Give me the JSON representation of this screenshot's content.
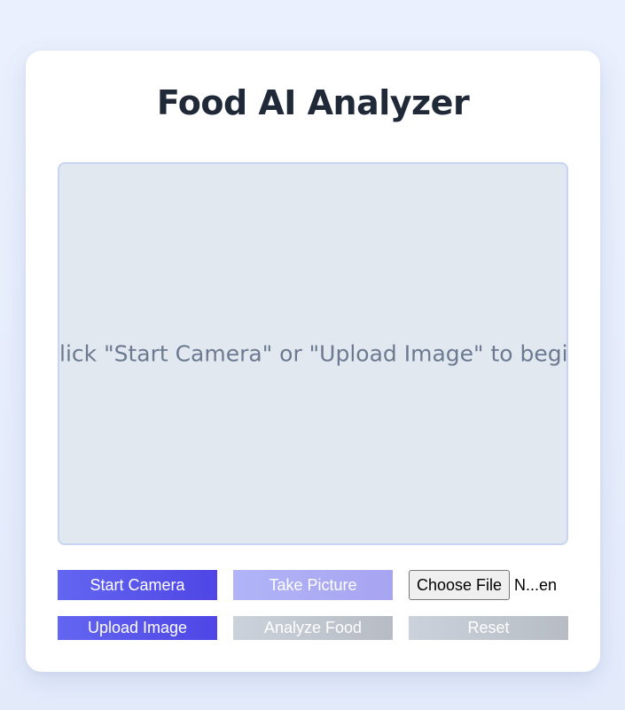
{
  "app": {
    "title": "Food AI Analyzer"
  },
  "preview": {
    "message": "Click \"Start Camera\" or \"Upload Image\" to begin"
  },
  "controls": {
    "start_camera": "Start Camera",
    "take_picture": "Take Picture",
    "choose_file": "Choose File",
    "file_status": "N...en",
    "upload_image": "Upload Image",
    "analyze_food": "Analyze Food",
    "reset": "Reset"
  },
  "colors": {
    "primary": "#4f46e5",
    "primary_disabled": "#a7a4f1",
    "gray_disabled": "#b7bcc4",
    "title": "#1f2937",
    "preview_bg": "#e2e8f0"
  }
}
